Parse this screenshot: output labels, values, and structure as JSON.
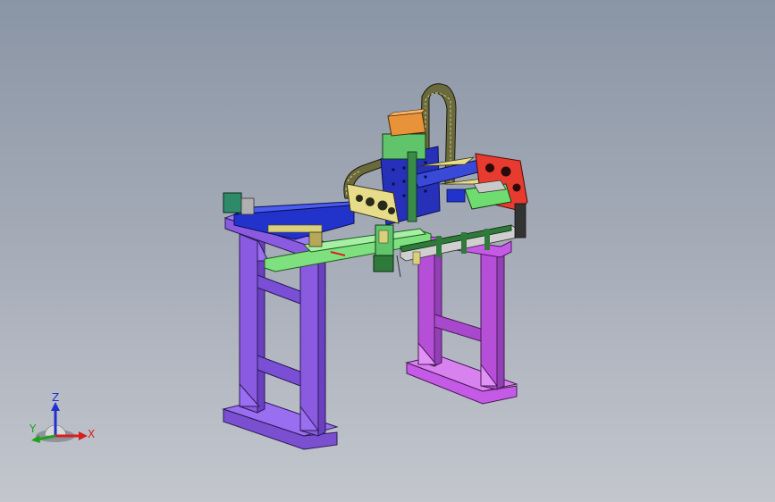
{
  "viewport": {
    "background_top": "#8a95a5",
    "background_bottom": "#c3c6cd"
  },
  "colors": {
    "frame_purple": "#8a5be0",
    "frame_magenta": "#c45ae6",
    "rail_blue": "#2233cc",
    "bracket_yellow": "#e6dc8a",
    "plate_red": "#e63b2e",
    "part_green": "#6fdc6f",
    "dark_green": "#2f7a3a",
    "motor_orange": "#e8923a",
    "drag_chain": "#6b6a3c"
  },
  "triad": {
    "x_label": "X",
    "y_label": "Y",
    "z_label": "Z",
    "x_color": "#d42020",
    "y_color": "#20a020",
    "z_color": "#2030d0"
  }
}
